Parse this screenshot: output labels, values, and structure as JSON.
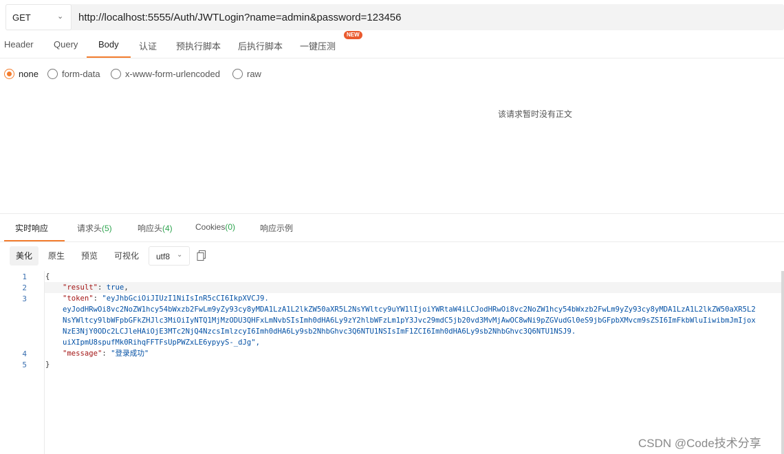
{
  "request": {
    "method": "GET",
    "url": "http://localhost:5555/Auth/JWTLogin?name=admin&password=123456"
  },
  "req_tabs": [
    {
      "label": "Header"
    },
    {
      "label": "Query"
    },
    {
      "label": "Body"
    },
    {
      "label": "认证"
    },
    {
      "label": "预执行脚本"
    },
    {
      "label": "后执行脚本"
    },
    {
      "label": "一键压测"
    }
  ],
  "new_badge": "NEW",
  "body_types": [
    {
      "label": "none",
      "checked": true
    },
    {
      "label": "form-data",
      "checked": false
    },
    {
      "label": "x-www-form-urlencoded",
      "checked": false
    },
    {
      "label": "raw",
      "checked": false
    }
  ],
  "empty_body_message": "该请求暂时没有正文",
  "resp_tabs": [
    {
      "label": "实时响应",
      "count": ""
    },
    {
      "label": "请求头",
      "count": "(5)"
    },
    {
      "label": "响应头",
      "count": "(4)"
    },
    {
      "label": "Cookies",
      "count": "(0)"
    },
    {
      "label": "响应示例",
      "count": ""
    }
  ],
  "view_modes": [
    "美化",
    "原生",
    "预览",
    "可视化"
  ],
  "encoding": "utf8",
  "line_numbers": [
    "1",
    "2",
    "3",
    "4",
    "5"
  ],
  "response": {
    "open_brace": "{",
    "close_brace": "}",
    "result_key": "\"result\"",
    "result_value": "true",
    "token_key": "\"token\"",
    "token_lines": [
      "\"eyJhbGciOiJIUzI1NiIsInR5cCI6IkpXVCJ9.",
      "eyJodHRwOi8vc2NoZW1hcy54bWxzb2FwLm9yZy93cy8yMDA1LzA1L2lkZW50aXR5L2NsYWltcy9uYW1lIjoiYWRtaW4iLCJodHRwOi8vc2NoZW1hcy54bWxzb2FwLm9yZy93cy8yMDA1LzA1L2lkZW50aXR5L2",
      "NsYWltcy9lbWFpbGFkZHJlc3MiOiIyNTQ1MjMzODU3QHFxLmNvbSIsImh0dHA6Ly9zY2hlbWFzLm1pY3Jvc29mdC5jb20vd3MvMjAwOC8wNi9pZGVudGl0eS9jbGFpbXMvcm9sZSI6ImFkbWluIiwibmJmIjox",
      "NzE3NjY0ODc2LCJleHAiOjE3MTc2NjQ4NzcsImlzcyI6Imh0dHA6Ly9sb2NhbGhvc3Q6NTU1NSIsImF1ZCI6Imh0dHA6Ly9sb2NhbGhvc3Q6NTU1NSJ9.",
      "uiXIpmU8spufMk0RihqFFTFsUpPWZxLE6ypyyS-_dJg\","
    ],
    "message_key": "\"message\"",
    "message_value": "\"登录成功\""
  },
  "watermark": "CSDN @Code技术分享"
}
